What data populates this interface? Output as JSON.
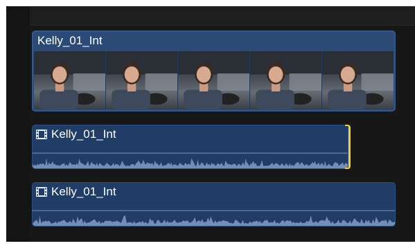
{
  "timeline": {
    "video_clip": {
      "title": "Kelly_01_Int",
      "thumbnail_count": 5,
      "fill_color": "#2b4a75"
    },
    "audio_clips": [
      {
        "title": "Kelly_01_Int",
        "icon": "filmstrip-icon",
        "fill_color": "#1f3d66",
        "trimmed": true
      },
      {
        "title": "Kelly_01_Int",
        "icon": "filmstrip-icon",
        "fill_color": "#1f3d66",
        "trimmed": false
      }
    ],
    "trim_handle_color": "#f5cf2b",
    "waveform_color": "#7f9cc4"
  }
}
